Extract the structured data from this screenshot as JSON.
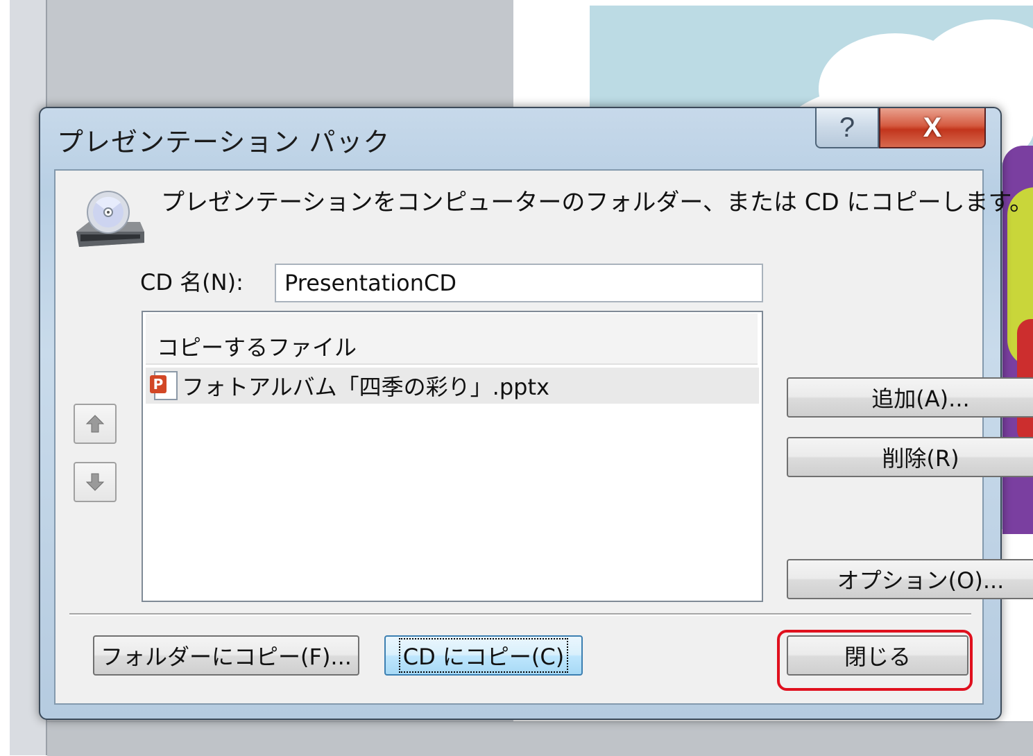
{
  "dialog": {
    "title": "プレゼンテーション パック",
    "help_button": "?",
    "close_button": "X",
    "intro_text": "プレゼンテーションをコンピューターのフォルダー、または CD にコピーします。",
    "cd_name_label": "CD 名(N):",
    "cd_name_value": "PresentationCD",
    "file_list": {
      "header": "コピーするファイル",
      "files": [
        "フォトアルバム「四季の彩り」.pptx"
      ]
    },
    "buttons": {
      "add": "追加(A)...",
      "remove": "削除(R)",
      "options": "オプション(O)...",
      "copy_to_folder": "フォルダーにコピー(F)...",
      "copy_to_cd": "CD にコピー(C)",
      "close": "閉じる"
    }
  },
  "icons": {
    "cd_drive": "cd-drive-icon",
    "move_up": "arrow-up-icon",
    "move_down": "arrow-down-icon",
    "file": "pptx-file-icon"
  },
  "colors": {
    "highlight": "#e0101e",
    "close_caption": "#c2351c",
    "default_button_border": "#3c7fb1"
  }
}
